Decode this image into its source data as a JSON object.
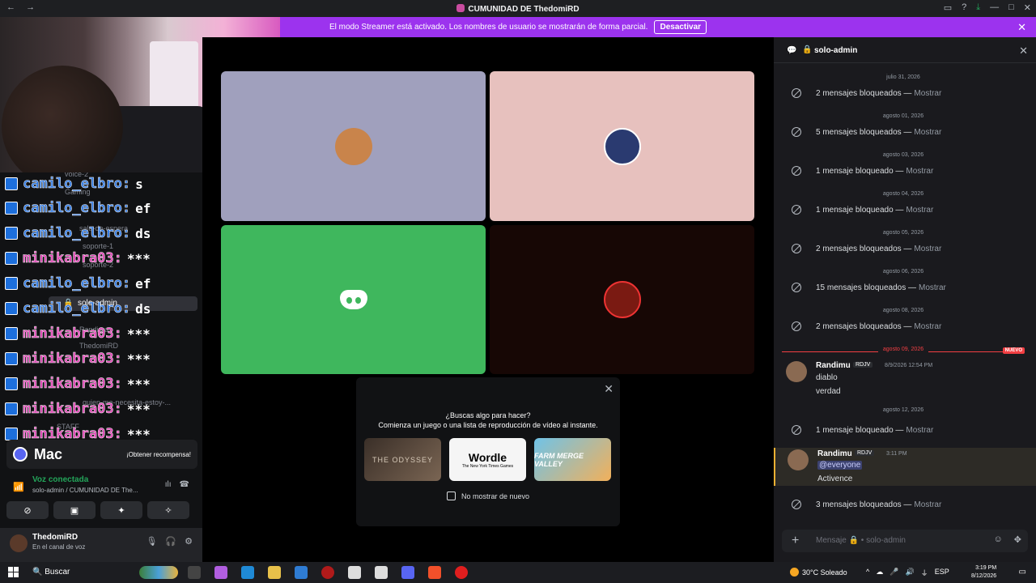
{
  "window": {
    "title": "CUMUNIDAD DE ThedomiRD",
    "nav_back": "←",
    "nav_fwd": "→",
    "controls": [
      "▭",
      "?",
      "⤓",
      "—",
      "□",
      "✕"
    ]
  },
  "banner": {
    "text": "El modo Streamer está activado. Los nombres de usuario se mostrarán de forma parcial.",
    "button": "Desactivar",
    "close": "✕"
  },
  "stream_chat": [
    {
      "user": "camilo_elbro:",
      "msg": "s",
      "color": "blue"
    },
    {
      "user": "camilo_elbro:",
      "msg": "ef",
      "color": "blue"
    },
    {
      "user": "camilo_elbro:",
      "msg": "ds",
      "color": "blue"
    },
    {
      "user": "minikabra03:",
      "msg": "***",
      "color": "pink"
    },
    {
      "user": "camilo_elbro:",
      "msg": "ef",
      "color": "blue"
    },
    {
      "user": "camilo_elbro:",
      "msg": "ds",
      "color": "blue"
    },
    {
      "user": "minikabra03:",
      "msg": "***",
      "color": "pink"
    },
    {
      "user": "minikabra03:",
      "msg": "***",
      "color": "pink"
    },
    {
      "user": "minikabra03:",
      "msg": "***",
      "color": "pink"
    },
    {
      "user": "minikabra03:",
      "msg": "***",
      "color": "pink"
    },
    {
      "user": "minikabra03:",
      "msg": "***",
      "color": "pink"
    }
  ],
  "sidebar": {
    "ghost_channels": [
      "voice-2",
      "Gaming",
      "sala-de-espera",
      "soporte-1",
      "soporte-2",
      "Randimu",
      "ThedomiRD",
      "quien-me-necesita-estoy-...",
      "STAFF"
    ],
    "active_channel": "solo-admin",
    "promo": {
      "logo": "Mac",
      "cta": "¡Obtener recompensa!"
    },
    "voice": {
      "status": "Voz conectada",
      "path": "solo-admin / CUMUNIDAD DE The..."
    },
    "voice_buttons": [
      "⊘",
      "▣",
      "✦",
      "✧"
    ],
    "user": {
      "name": "ThedomiRD",
      "status": "En el canal de voz"
    }
  },
  "stage": {
    "activity": {
      "headline": "¿Buscas algo para hacer?",
      "subline": "Comienza un juego o una lista de reproducción de vídeo al instante.",
      "games": [
        "THE ODYSSEY",
        "Wordle",
        "FARM MERGE VALLEY"
      ],
      "wordle_sub": "The New York Times Games",
      "checkbox": "No mostrar de nuevo",
      "close": "✕"
    }
  },
  "thread": {
    "title": "solo-admin",
    "composer_placeholder": "Mensaje 🔒 • solo-admin",
    "entries": [
      {
        "kind": "date",
        "text": "julio 31, 2026"
      },
      {
        "kind": "blocked",
        "text": "2 mensajes bloqueados —",
        "link": "Mostrar"
      },
      {
        "kind": "date",
        "text": "agosto 01, 2026"
      },
      {
        "kind": "blocked",
        "text": "5 mensajes bloqueados —",
        "link": "Mostrar"
      },
      {
        "kind": "date",
        "text": "agosto 03, 2026"
      },
      {
        "kind": "blocked",
        "text": "1 mensaje bloqueado —",
        "link": "Mostrar"
      },
      {
        "kind": "date",
        "text": "agosto 04, 2026"
      },
      {
        "kind": "blocked",
        "text": "1 mensaje bloqueado —",
        "link": "Mostrar"
      },
      {
        "kind": "date",
        "text": "agosto 05, 2026"
      },
      {
        "kind": "blocked",
        "text": "2 mensajes bloqueados —",
        "link": "Mostrar"
      },
      {
        "kind": "date",
        "text": "agosto 06, 2026"
      },
      {
        "kind": "blocked",
        "text": "15 mensajes bloqueados —",
        "link": "Mostrar"
      },
      {
        "kind": "date",
        "text": "agosto 08, 2026"
      },
      {
        "kind": "blocked",
        "text": "2 mensajes bloqueados —",
        "link": "Mostrar"
      },
      {
        "kind": "date_new",
        "text": "agosto 09, 2026",
        "badge": "NUEVO"
      }
    ],
    "msg1": {
      "name": "Randimu",
      "tag": "RDJV",
      "time": "8/9/2026 12:54 PM",
      "lines": [
        "diablo",
        "verdad"
      ]
    },
    "date_12": "agosto 12, 2026",
    "blocked_12": {
      "text": "1 mensaje bloqueado —",
      "link": "Mostrar"
    },
    "msg2": {
      "name": "Randimu",
      "tag": "RDJV",
      "time": "3:11 PM",
      "mention": "@everyone",
      "line": "Activence"
    },
    "blocked_last": {
      "text": "3 mensajes bloqueados —",
      "link": "Mostrar"
    }
  },
  "taskbar": {
    "search": "Buscar",
    "weather": "30°C Soleado",
    "lang": "ESP",
    "time": "3:19 PM",
    "date": "8/12/2026"
  }
}
